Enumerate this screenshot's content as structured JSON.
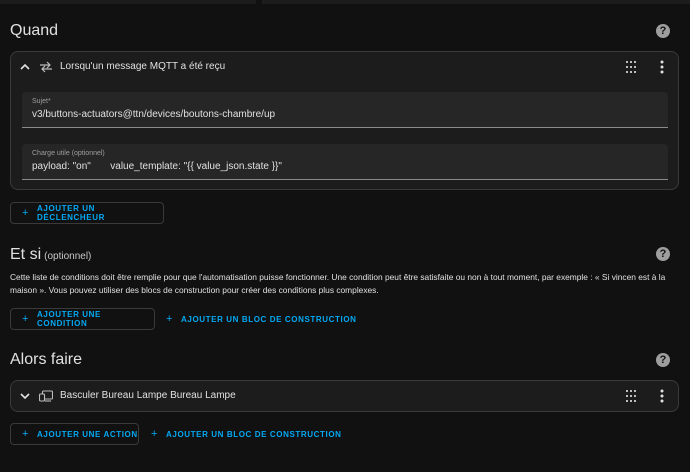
{
  "trigger_section": {
    "title": "Quand",
    "trigger": {
      "title": "Lorsqu'un message MQTT a été reçu",
      "topic": {
        "label": "Sujet*",
        "value": "v3/buttons-actuators@ttn/devices/boutons-chambre/up"
      },
      "payload": {
        "label": "Charge utile (optionnel)",
        "value": "payload: \"on\"       value_template: \"{{ value_json.state }}\""
      }
    },
    "add_trigger_label": "AJOUTER UN DÉCLENCHEUR"
  },
  "condition_section": {
    "title": "Et si",
    "optional": "(optionnel)",
    "description": "Cette liste de conditions doit être remplie pour que l'automatisation puisse fonctionner. Une condition peut être satisfaite ou non à tout moment, par exemple : « Si vincen est à la maison ». Vous pouvez utiliser des blocs de construction pour créer des conditions plus complexes.",
    "add_condition_label": "AJOUTER UNE CONDITION",
    "add_building_block_label": "AJOUTER UN BLOC DE CONSTRUCTION"
  },
  "action_section": {
    "title": "Alors faire",
    "action": {
      "title": "Basculer Bureau Lampe Bureau Lampe"
    },
    "add_action_label": "AJOUTER UNE ACTION",
    "add_building_block_label": "AJOUTER UN BLOC DE CONSTRUCTION"
  },
  "colors": {
    "accent": "#03a9f4",
    "background": "#111111",
    "card": "#1c1c1c",
    "field": "#262626"
  },
  "icons": {
    "help": "help-circle-icon",
    "swap": "swap-arrows-icon",
    "device": "devices-icon",
    "grip": "drag-handle-icon",
    "menu": "dots-vertical-icon",
    "chevron": "chevron-icon",
    "plus": "plus-icon"
  }
}
